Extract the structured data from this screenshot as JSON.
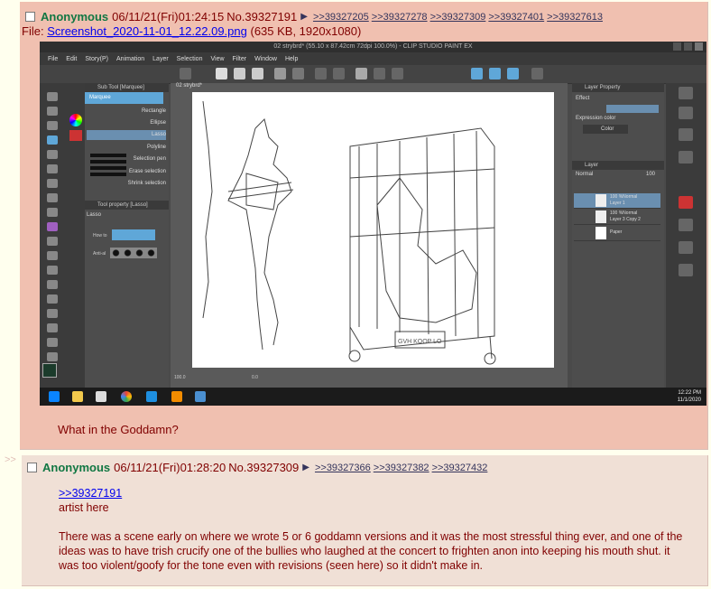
{
  "thread_arrows": ">>",
  "post1": {
    "name": "Anonymous",
    "datetime": "06/11/21(Fri)01:24:15",
    "number": "No.39327191",
    "replies": [
      ">>39327205",
      ">>39327278",
      ">>39327309",
      ">>39327401",
      ">>39327613"
    ],
    "file_label": "File:",
    "file_name": "Screenshot_2020-11-01_12.22.09.png",
    "file_info": "(635 KB, 1920x1080)",
    "message": "What in the Goddamn?"
  },
  "screenshot": {
    "title": "02 strybrd* (55.10 x 87.42cm 72dpi 100.0%) - CLIP STUDIO PAINT EX",
    "menu": [
      "File",
      "Edit",
      "Story(P)",
      "Animation",
      "Layer",
      "Selection",
      "View",
      "Filter",
      "Window",
      "Help"
    ],
    "canvas_tab": "02 strybrd*",
    "subtool_title": "Sub Tool [Marquee]",
    "subtool_group": "Marquee",
    "subtool_items": [
      "Rectangle",
      "Ellipse",
      "Lasso",
      "Polyline",
      "Selection pen",
      "Erase selection",
      "Shrink selection"
    ],
    "tool_property_title": "Tool property [Lasso]",
    "tool_property_name": "Lasso",
    "how_to_label": "How to",
    "anti_alias_label": "Anti-al",
    "layer_property_title": "Layer Property",
    "effect_label": "Effect",
    "expression_color_label": "Expression color",
    "color_value": "Color",
    "layer_panel_title": "Layer",
    "blend_mode": "Normal",
    "opacity_value": "100",
    "layers": [
      {
        "opacity": "100 %Normal",
        "name": "Layer 1"
      },
      {
        "opacity": "100 %Normal",
        "name": "Layer 3 Copy 2"
      },
      {
        "opacity": "",
        "name": "Paper"
      }
    ],
    "zoom_value": "100.0",
    "rotation_value": "0.0",
    "cage_sign_text": "GVH KOOP LO",
    "clock_time": "12:22 PM",
    "clock_date": "11/1/2020"
  },
  "post2": {
    "name": "Anonymous",
    "datetime": "06/11/21(Fri)01:28:20",
    "number": "No.39327309",
    "replies": [
      ">>39327366",
      ">>39327382",
      ">>39327432"
    ],
    "quote_link": ">>39327191",
    "line1": "artist here",
    "paragraph": "There was a scene early on where we wrote 5 or 6 goddamn versions and it was the most stressful thing ever, and one of the ideas was to have trish crucify one of the bullies who laughed at the concert to frighten anon into keeping his mouth shut. it was too violent/goofy for the tone even with revisions (seen here) so it didn't make in."
  },
  "colors": {
    "page_bg": "#ffffee",
    "highlight_post": "#f0c0b0",
    "post_bg": "#f0e0d6",
    "name": "#117743",
    "text": "#800000",
    "link": "#34345c"
  }
}
